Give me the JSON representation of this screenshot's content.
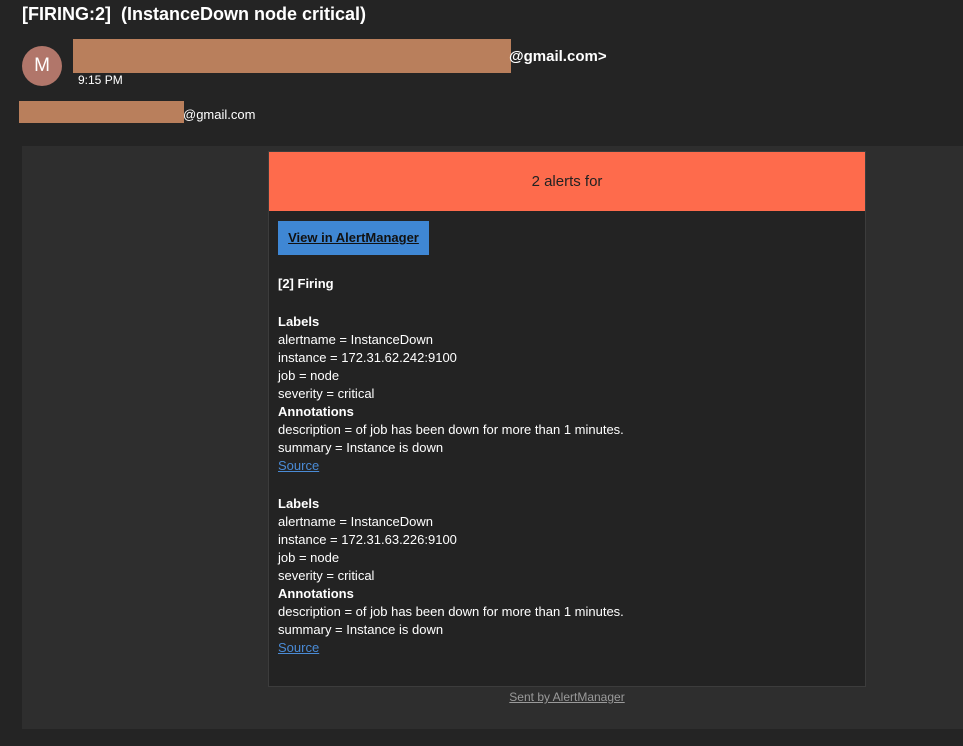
{
  "email": {
    "subject": "[FIRING:2]  (InstanceDown node critical)",
    "avatar_letter": "M",
    "sender_suffix": "@gmail.com>",
    "time": "9:15 PM",
    "recipient_suffix": "@gmail.com"
  },
  "alert_card": {
    "header": "2 alerts for",
    "header_color": "#fe6b4c",
    "button_label": "View in AlertManager",
    "button_color": "#3f87d4",
    "firing_title": "[2] Firing",
    "alerts": [
      {
        "labels_title": "Labels",
        "labels": [
          "alertname = InstanceDown",
          "instance = 172.31.62.242:9100",
          "job = node",
          "severity = critical"
        ],
        "annotations_title": "Annotations",
        "annotations": [
          "description = of job has been down for more than 1 minutes.",
          "summary = Instance is down"
        ],
        "source_label": "Source"
      },
      {
        "labels_title": "Labels",
        "labels": [
          "alertname = InstanceDown",
          "instance = 172.31.63.226:9100",
          "job = node",
          "severity = critical"
        ],
        "annotations_title": "Annotations",
        "annotations": [
          "description = of job has been down for more than 1 minutes.",
          "summary = Instance is down"
        ],
        "source_label": "Source"
      }
    ],
    "footer": "Sent by AlertManager"
  }
}
